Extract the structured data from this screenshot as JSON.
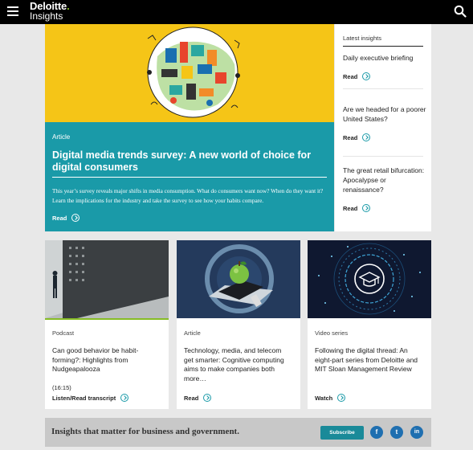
{
  "header": {
    "brand": "Deloitte",
    "brand_dot": ".",
    "brand_sub": "Insights",
    "menu_icon": "hamburger-icon",
    "search_icon": "search-icon"
  },
  "hero": {
    "tag": "Article",
    "title": "Digital media trends survey: A new world of choice for digital consumers",
    "description": "This year’s survey reveals major shifts in media consumption. What do consumers want now? When do they want it? Learn the implications for the industry and take the survey to see how your habits compare.",
    "read_label": "Read",
    "colors": {
      "image_bg": "#f5c517",
      "body_bg": "#1a9aa8"
    }
  },
  "latest": {
    "heading": "Latest insights",
    "items": [
      {
        "title": "Daily executive briefing",
        "read_label": "Read"
      },
      {
        "title": "Are we headed for a poorer United States?",
        "read_label": "Read"
      },
      {
        "title": "The great retail bifurcation: Apocalypse or renaissance?",
        "read_label": "Read"
      }
    ]
  },
  "cards": [
    {
      "tag": "Podcast",
      "title": "Can good behavior be habit-forming?: Highlights from Nudgeapalooza",
      "duration": "(16:15)",
      "action_label": "Listen/Read transcript",
      "icon": "speaker-icon",
      "accent": "#86bc25"
    },
    {
      "tag": "Article",
      "title": "Technology, media, and telecom get smarter: Cognitive computing aims to make companies both more…",
      "action_label": "Read",
      "icon": "apple-icon"
    },
    {
      "tag": "Video series",
      "title": "Following the digital thread: An eight-part series from Deloitte and MIT Sloan Management Review",
      "action_label": "Watch",
      "icon": "graduation-cap-icon"
    }
  ],
  "banner": {
    "text": "Insights that matter for business and government.",
    "subscribe_label": "Subscribe",
    "social": [
      {
        "name": "facebook",
        "glyph": "f"
      },
      {
        "name": "twitter",
        "glyph": "t"
      },
      {
        "name": "linkedin",
        "glyph": "in"
      }
    ]
  }
}
